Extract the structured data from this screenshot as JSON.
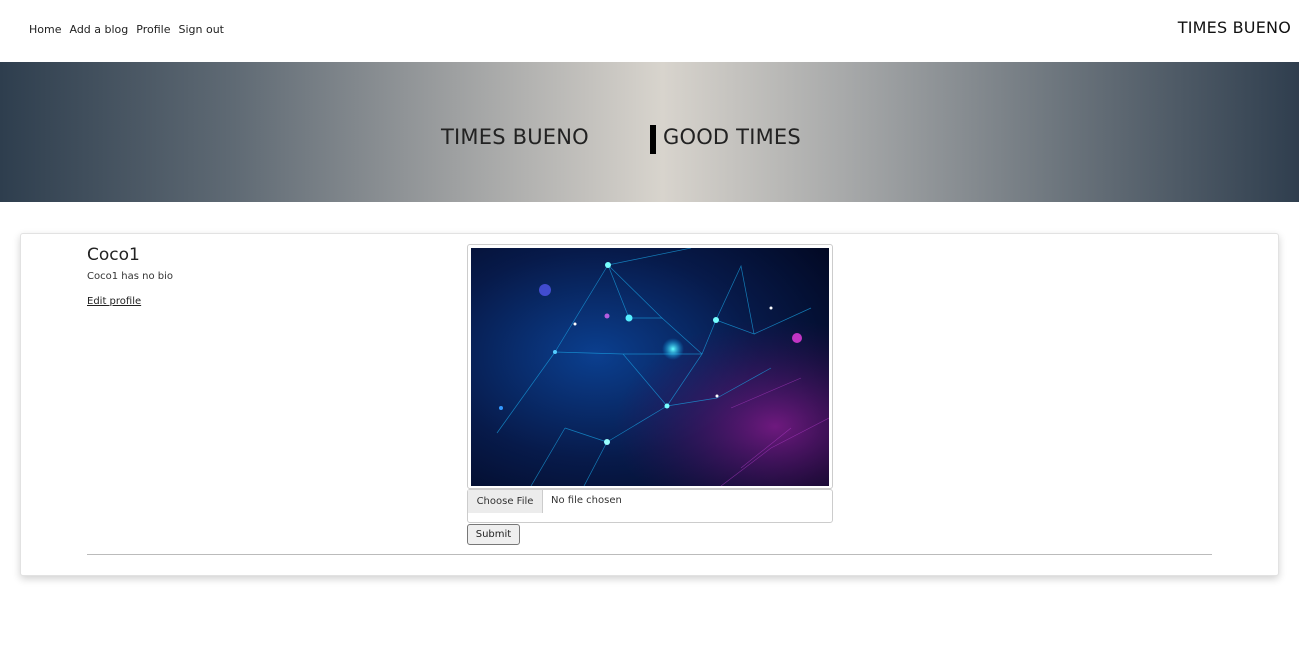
{
  "nav": {
    "links": [
      "Home",
      "Add a blog",
      "Profile",
      "Sign out"
    ],
    "brand": "TIMES BUENO"
  },
  "hero": {
    "left_title": "TIMES BUENO",
    "right_title": "GOOD TIMES"
  },
  "profile": {
    "username": "Coco1",
    "bio": "Coco1 has no bio",
    "edit_label": "Edit profile"
  },
  "upload": {
    "choose_label": "Choose File",
    "status": "No file chosen",
    "submit_label": "Submit"
  }
}
